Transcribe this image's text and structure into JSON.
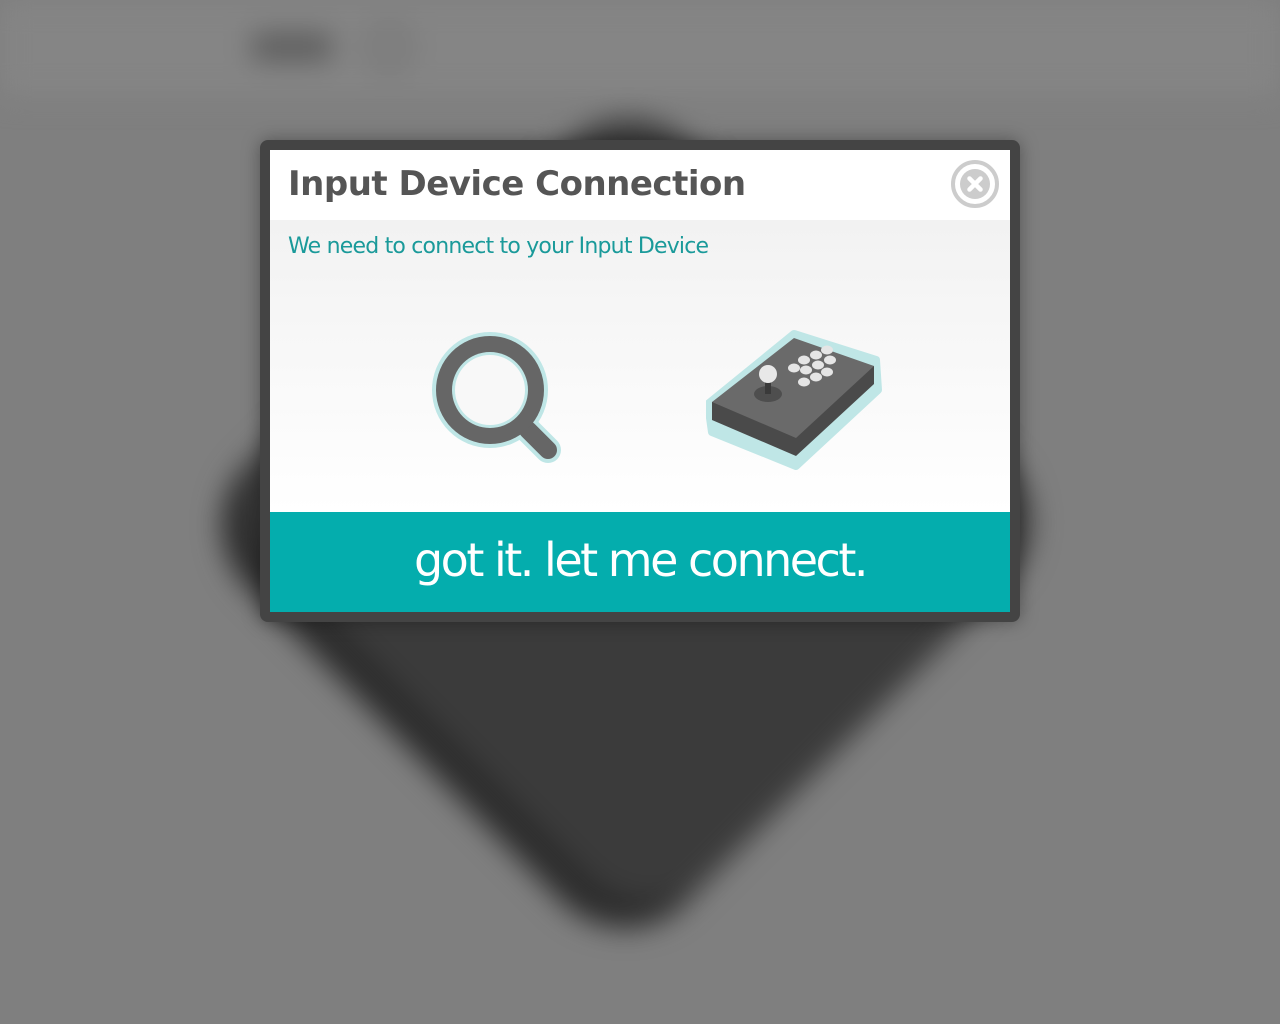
{
  "modal": {
    "title": "Input Device Connection",
    "subtitle": "We need to connect to your Input Device",
    "close_icon": "close-circle-icon",
    "illustrations": [
      "search-icon",
      "arcade-stick-icon"
    ],
    "confirm_label": "got it. let me connect."
  },
  "colors": {
    "accent": "#04adad",
    "accent_text": "#1a9a9a",
    "title_text": "#555555",
    "icon_gray": "#666666",
    "icon_outline": "#bfe6e6",
    "overlay": "#7f7f7f"
  }
}
